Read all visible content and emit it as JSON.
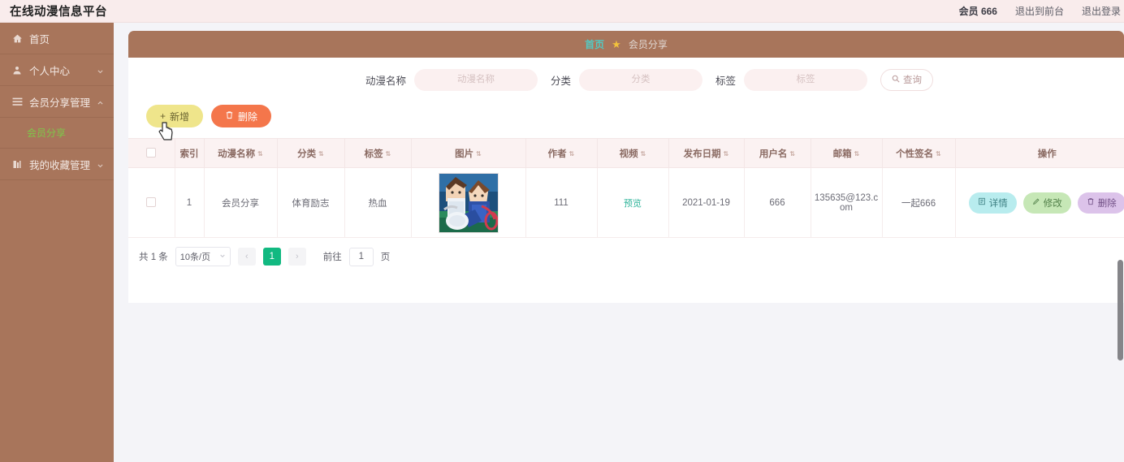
{
  "header": {
    "brand": "在线动漫信息平台",
    "user_label": "会员 666",
    "exit_front_label": "退出到前台",
    "logout_label": "退出登录"
  },
  "sidebar": {
    "items": [
      {
        "label": "首页",
        "icon": "home-icon",
        "chevron": "",
        "active": false
      },
      {
        "label": "个人中心",
        "icon": "user-icon",
        "chevron": "down",
        "active": false
      },
      {
        "label": "会员分享管理",
        "icon": "list-icon",
        "chevron": "up",
        "active": false
      },
      {
        "label": "我的收藏管理",
        "icon": "book-icon",
        "chevron": "down",
        "active": false
      }
    ],
    "submenu": {
      "label": "会员分享",
      "parent": "会员分享管理",
      "active": true
    }
  },
  "breadcrumb": {
    "home": "首页",
    "star": "★",
    "current": "会员分享"
  },
  "search": {
    "fields": [
      {
        "label": "动漫名称",
        "placeholder": "动漫名称",
        "value": ""
      },
      {
        "label": "分类",
        "placeholder": "分类",
        "value": ""
      },
      {
        "label": "标签",
        "placeholder": "标签",
        "value": ""
      }
    ],
    "query_button": "查询",
    "query_icon": "search-icon"
  },
  "toolbar": {
    "add_label": "新增",
    "add_icon": "plus-icon",
    "delete_label": "删除",
    "delete_icon": "trash-icon"
  },
  "table": {
    "columns": [
      {
        "key": "check",
        "label": "",
        "sortable": false
      },
      {
        "key": "index",
        "label": "索引",
        "sortable": false
      },
      {
        "key": "name",
        "label": "动漫名称",
        "sortable": true
      },
      {
        "key": "category",
        "label": "分类",
        "sortable": true
      },
      {
        "key": "tag",
        "label": "标签",
        "sortable": true
      },
      {
        "key": "image",
        "label": "图片",
        "sortable": true
      },
      {
        "key": "author",
        "label": "作者",
        "sortable": true
      },
      {
        "key": "video",
        "label": "视频",
        "sortable": true
      },
      {
        "key": "date",
        "label": "发布日期",
        "sortable": true
      },
      {
        "key": "username",
        "label": "用户名",
        "sortable": true
      },
      {
        "key": "email",
        "label": "邮箱",
        "sortable": true
      },
      {
        "key": "signature",
        "label": "个性签名",
        "sortable": true
      },
      {
        "key": "ops",
        "label": "操作",
        "sortable": false
      }
    ],
    "rows": [
      {
        "index": "1",
        "name": "会员分享",
        "category": "体育励志",
        "tag": "热血",
        "image_alt": "anime-thumbnail",
        "author": "111",
        "video": "预览",
        "date": "2021-01-19",
        "username": "666",
        "email": "135635@123.com",
        "signature": "一起666",
        "ops": {
          "detail": "详情",
          "edit": "修改",
          "delete": "删除"
        }
      }
    ]
  },
  "pagination": {
    "total_label": "共 1 条",
    "page_size_label": "10条/页",
    "prev_icon": "chevron-left-icon",
    "next_icon": "chevron-right-icon",
    "current_page": "1",
    "goto_label": "前往",
    "goto_value": "1",
    "goto_unit": "页"
  },
  "colors": {
    "sidebar": "#a8755b",
    "header": "#f9ecec",
    "accent_green": "#12b981",
    "add_button": "#efe58b",
    "delete_button": "#f4764b",
    "breadcrumb_link": "#53c9c2"
  }
}
